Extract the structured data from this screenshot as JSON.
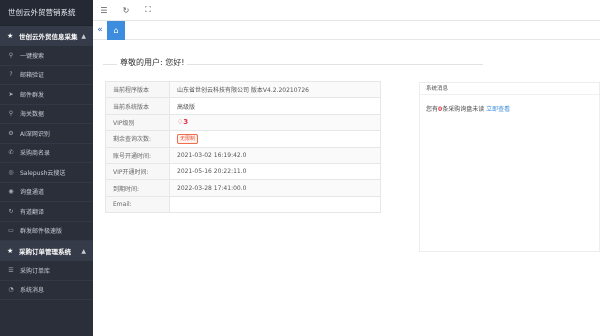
{
  "brand": "世创云外贸营销系统",
  "sidebar": {
    "section1": "世创云外贸信息采集",
    "items1": [
      {
        "label": "一键搜索",
        "icon": "search-icon",
        "glyph": "⚲"
      },
      {
        "label": "邮箱验证",
        "icon": "help-icon",
        "glyph": "?"
      },
      {
        "label": "邮件群发",
        "icon": "send-icon",
        "glyph": "➤"
      },
      {
        "label": "海关数据",
        "icon": "search-icon",
        "glyph": "⚲"
      },
      {
        "label": "AI深网识别",
        "icon": "ai-icon",
        "glyph": "⚙"
      },
      {
        "label": "采购商名录",
        "icon": "phone-icon",
        "glyph": "✆"
      },
      {
        "label": "Salepush云搜送",
        "icon": "globe-icon",
        "glyph": "◎"
      },
      {
        "label": "询盘通道",
        "icon": "target-icon",
        "glyph": "◉"
      },
      {
        "label": "有道翻译",
        "icon": "translate-icon",
        "glyph": "↻"
      },
      {
        "label": "群发邮件极速版",
        "icon": "mail-icon",
        "glyph": "▭"
      }
    ],
    "section2": "采购订单管理系统",
    "items2": [
      {
        "label": "采购订单库",
        "icon": "list-icon",
        "glyph": "☰"
      },
      {
        "label": "系统消息",
        "icon": "bell-icon",
        "glyph": "◔"
      }
    ]
  },
  "greeting": "尊敬的用户: 您好!",
  "info": {
    "rows": [
      {
        "key": "当前程序版本",
        "value": "山东省世创云科技有限公司 版本V4.2.20210726"
      },
      {
        "key": "当前系统版本",
        "value": "高级版"
      },
      {
        "key": "VIP级别",
        "value": "3"
      },
      {
        "key": "剩余查询次数:",
        "value": "无限制"
      },
      {
        "key": "账号开通时间:",
        "value": "2021-03-02 16:19:42.0"
      },
      {
        "key": "VIP开通时间:",
        "value": "2021-05-16 20:22:11.0"
      },
      {
        "key": "到期时间:",
        "value": "2022-03-28 17:41:00.0"
      },
      {
        "key": "Email:",
        "value": ""
      }
    ]
  },
  "messages": {
    "title": "系统消息",
    "prefix": "您有",
    "count": "0",
    "suffix": "条采购询盘未读",
    "link": "立即查看"
  },
  "colors": {
    "sidebar": "#2a2f3a",
    "accent": "#3c8dde",
    "vip": "#e0334b"
  }
}
